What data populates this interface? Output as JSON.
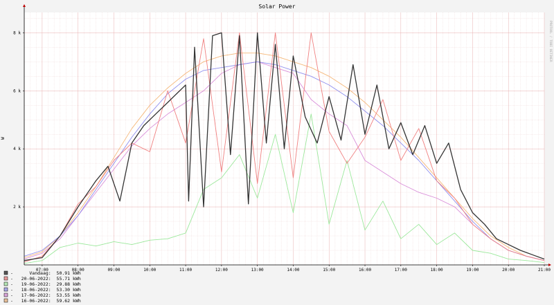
{
  "chart_data": {
    "type": "line",
    "title": "Solar Power",
    "ylabel": "W",
    "xlabel": "",
    "side_text": "PROTOOL / TOBI OETIKER",
    "x_range": [
      "06:30",
      "21:00"
    ],
    "ylim": [
      0,
      8700
    ],
    "x_ticks": [
      "07:00",
      "08:00",
      "09:00",
      "10:00",
      "11:00",
      "12:00",
      "13:00",
      "14:00",
      "15:00",
      "16:00",
      "17:00",
      "18:00",
      "19:00",
      "20:00",
      "21:00"
    ],
    "y_ticks": [
      {
        "value": 2000,
        "label": "2 k"
      },
      {
        "value": 4000,
        "label": "4 k"
      },
      {
        "value": 6000,
        "label": "6 k"
      },
      {
        "value": 8000,
        "label": "8 k"
      }
    ],
    "grid": true,
    "legend_placement": "bottom-left",
    "series": [
      {
        "name": "Vandaag",
        "label_prefix": "-",
        "total": "50.91 kWh",
        "color": "#333333",
        "swatch": "#555555",
        "x": [
          "06:30",
          "07:00",
          "07:30",
          "08:00",
          "08:30",
          "08:50",
          "09:10",
          "09:30",
          "09:50",
          "10:10",
          "10:30",
          "10:45",
          "11:00",
          "11:05",
          "11:15",
          "11:30",
          "11:45",
          "12:00",
          "12:15",
          "12:30",
          "12:45",
          "13:00",
          "13:15",
          "13:30",
          "13:45",
          "14:00",
          "14:20",
          "14:40",
          "15:00",
          "15:20",
          "15:40",
          "16:00",
          "16:20",
          "16:40",
          "17:00",
          "17:20",
          "17:40",
          "18:00",
          "18:20",
          "18:40",
          "19:00",
          "19:20",
          "19:40",
          "20:00",
          "20:20",
          "20:40",
          "21:00"
        ],
        "y": [
          150,
          250,
          1000,
          2000,
          2900,
          3400,
          2200,
          4200,
          4800,
          5200,
          5600,
          5900,
          6200,
          2200,
          7500,
          2000,
          7900,
          8000,
          3800,
          7900,
          2100,
          8000,
          4200,
          7600,
          4000,
          7200,
          5100,
          4200,
          5800,
          4300,
          6900,
          4500,
          6200,
          4000,
          4900,
          3800,
          4800,
          3500,
          4200,
          2600,
          1800,
          1400,
          900,
          700,
          500,
          350,
          200
        ]
      },
      {
        "name": "20-06-2022",
        "label_prefix": "-",
        "total": "55.71 kWh",
        "color": "#f08080",
        "swatch": "#e89a9a",
        "x": [
          "06:30",
          "07:00",
          "07:30",
          "08:00",
          "08:30",
          "09:00",
          "09:30",
          "10:00",
          "10:30",
          "11:00",
          "11:30",
          "12:00",
          "12:30",
          "13:00",
          "13:30",
          "14:00",
          "14:30",
          "15:00",
          "15:30",
          "16:00",
          "16:30",
          "17:00",
          "17:30",
          "18:00",
          "18:30",
          "19:00",
          "19:30",
          "20:00",
          "20:30",
          "21:00"
        ],
        "y": [
          100,
          300,
          1000,
          2100,
          2700,
          3600,
          4200,
          3900,
          6000,
          4200,
          7800,
          3200,
          8000,
          2800,
          8000,
          3000,
          8000,
          4600,
          3500,
          4400,
          5700,
          3600,
          4700,
          2900,
          2300,
          1400,
          900,
          500,
          300,
          150
        ]
      },
      {
        "name": "19-06-2022",
        "label_prefix": "-",
        "total": "29.88 kWh",
        "color": "#9be89b",
        "swatch": "#b5e8b5",
        "x": [
          "06:30",
          "07:00",
          "07:30",
          "08:00",
          "08:30",
          "09:00",
          "09:30",
          "10:00",
          "10:30",
          "11:00",
          "11:30",
          "12:00",
          "12:30",
          "13:00",
          "13:30",
          "14:00",
          "14:30",
          "15:00",
          "15:30",
          "16:00",
          "16:30",
          "17:00",
          "17:30",
          "18:00",
          "18:30",
          "19:00",
          "19:30",
          "20:00",
          "20:30",
          "21:00"
        ],
        "y": [
          50,
          150,
          600,
          750,
          650,
          800,
          700,
          850,
          900,
          1100,
          2600,
          3000,
          3800,
          2300,
          4500,
          1800,
          5200,
          1400,
          3600,
          1200,
          2200,
          900,
          1400,
          700,
          1100,
          500,
          400,
          200,
          150,
          80
        ]
      },
      {
        "name": "18-06-2022",
        "label_prefix": "-",
        "total": "53.30 kWh",
        "color": "#8f8fee",
        "swatch": "#a8a8e6",
        "x": [
          "06:30",
          "07:00",
          "07:30",
          "08:00",
          "08:30",
          "09:00",
          "09:30",
          "10:00",
          "10:30",
          "11:00",
          "11:30",
          "12:00",
          "12:30",
          "13:00",
          "13:30",
          "14:00",
          "14:30",
          "15:00",
          "15:30",
          "16:00",
          "16:30",
          "17:00",
          "17:30",
          "18:00",
          "18:30",
          "19:00",
          "19:30",
          "20:00",
          "20:30",
          "21:00"
        ],
        "y": [
          300,
          500,
          1000,
          1700,
          2600,
          3500,
          4400,
          5200,
          5900,
          6400,
          6700,
          6800,
          6900,
          7000,
          6900,
          6700,
          6500,
          6200,
          5800,
          5300,
          4800,
          4200,
          3600,
          2900,
          2200,
          1500,
          900,
          500,
          300,
          150
        ]
      },
      {
        "name": "17-06-2022",
        "label_prefix": "-",
        "total": "53.55 kWh",
        "color": "#d98ed9",
        "swatch": "#dba7db",
        "x": [
          "06:30",
          "07:00",
          "07:30",
          "08:00",
          "08:30",
          "09:00",
          "09:30",
          "10:00",
          "10:30",
          "11:00",
          "11:30",
          "12:00",
          "12:30",
          "13:00",
          "13:30",
          "14:00",
          "14:30",
          "15:00",
          "15:30",
          "16:00",
          "16:30",
          "17:00",
          "17:30",
          "18:00",
          "18:30",
          "19:00",
          "19:30",
          "20:00",
          "20:30",
          "21:00"
        ],
        "y": [
          200,
          400,
          900,
          1700,
          2500,
          3300,
          4100,
          4700,
          5200,
          5600,
          6000,
          6600,
          6900,
          7000,
          6800,
          6600,
          5700,
          5200,
          4800,
          3600,
          3200,
          2800,
          2500,
          2300,
          2000,
          1400,
          900,
          500,
          300,
          150
        ]
      },
      {
        "name": "16-06-2022",
        "label_prefix": "-",
        "total": "59.62 kWh",
        "color": "#f5b87a",
        "swatch": "#e8c09a",
        "x": [
          "06:30",
          "07:00",
          "07:30",
          "08:00",
          "08:30",
          "09:00",
          "09:30",
          "10:00",
          "10:30",
          "11:00",
          "11:30",
          "12:00",
          "12:30",
          "13:00",
          "13:30",
          "14:00",
          "14:30",
          "15:00",
          "15:30",
          "16:00",
          "16:30",
          "17:00",
          "17:30",
          "18:00",
          "18:30",
          "19:00",
          "19:30",
          "20:00",
          "20:30",
          "21:00"
        ],
        "y": [
          250,
          450,
          1000,
          1800,
          2700,
          3700,
          4700,
          5500,
          6100,
          6600,
          7000,
          7200,
          7300,
          7300,
          7200,
          7000,
          6800,
          6500,
          6100,
          5600,
          5000,
          4400,
          3700,
          3000,
          2300,
          1600,
          1000,
          600,
          300,
          150
        ]
      }
    ]
  }
}
